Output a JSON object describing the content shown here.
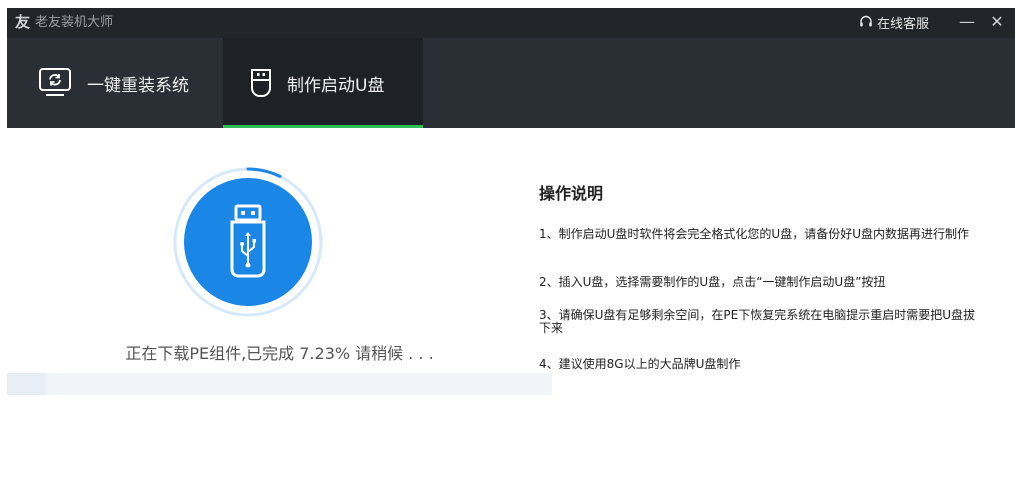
{
  "window": {
    "title": "老友装机大师",
    "support_label": "在线客服",
    "minimize_glyph": "—",
    "close_glyph": "✕"
  },
  "tabs": [
    {
      "label": "一键重装系统",
      "icon": "monitor-refresh-icon",
      "active": false
    },
    {
      "label": "制作启动U盘",
      "icon": "usb-drive-icon",
      "active": true
    }
  ],
  "colors": {
    "accent": "#1a86e6",
    "tab_underline": "#2fbd57",
    "titlebar": "#22262b",
    "navbar": "#2a2f35"
  },
  "status": {
    "text": "正在下载PE组件,已完成 7.23% 请稍候 . . .",
    "progress": 0.0723
  },
  "help": {
    "title": "操作说明",
    "items": [
      "1、制作启动U盘时软件将会完全格式化您的U盘，请备份好U盘内数据再进行制作",
      "2、插入U盘，选择需要制作的U盘，点击“一键制作启动U盘”按扭",
      "3、请确保U盘有足够剩余空间，在PE下恢复完系统在电脑提示重启时需要把U盘拔下来",
      "4、建议使用8G以上的大品牌U盘制作"
    ]
  }
}
